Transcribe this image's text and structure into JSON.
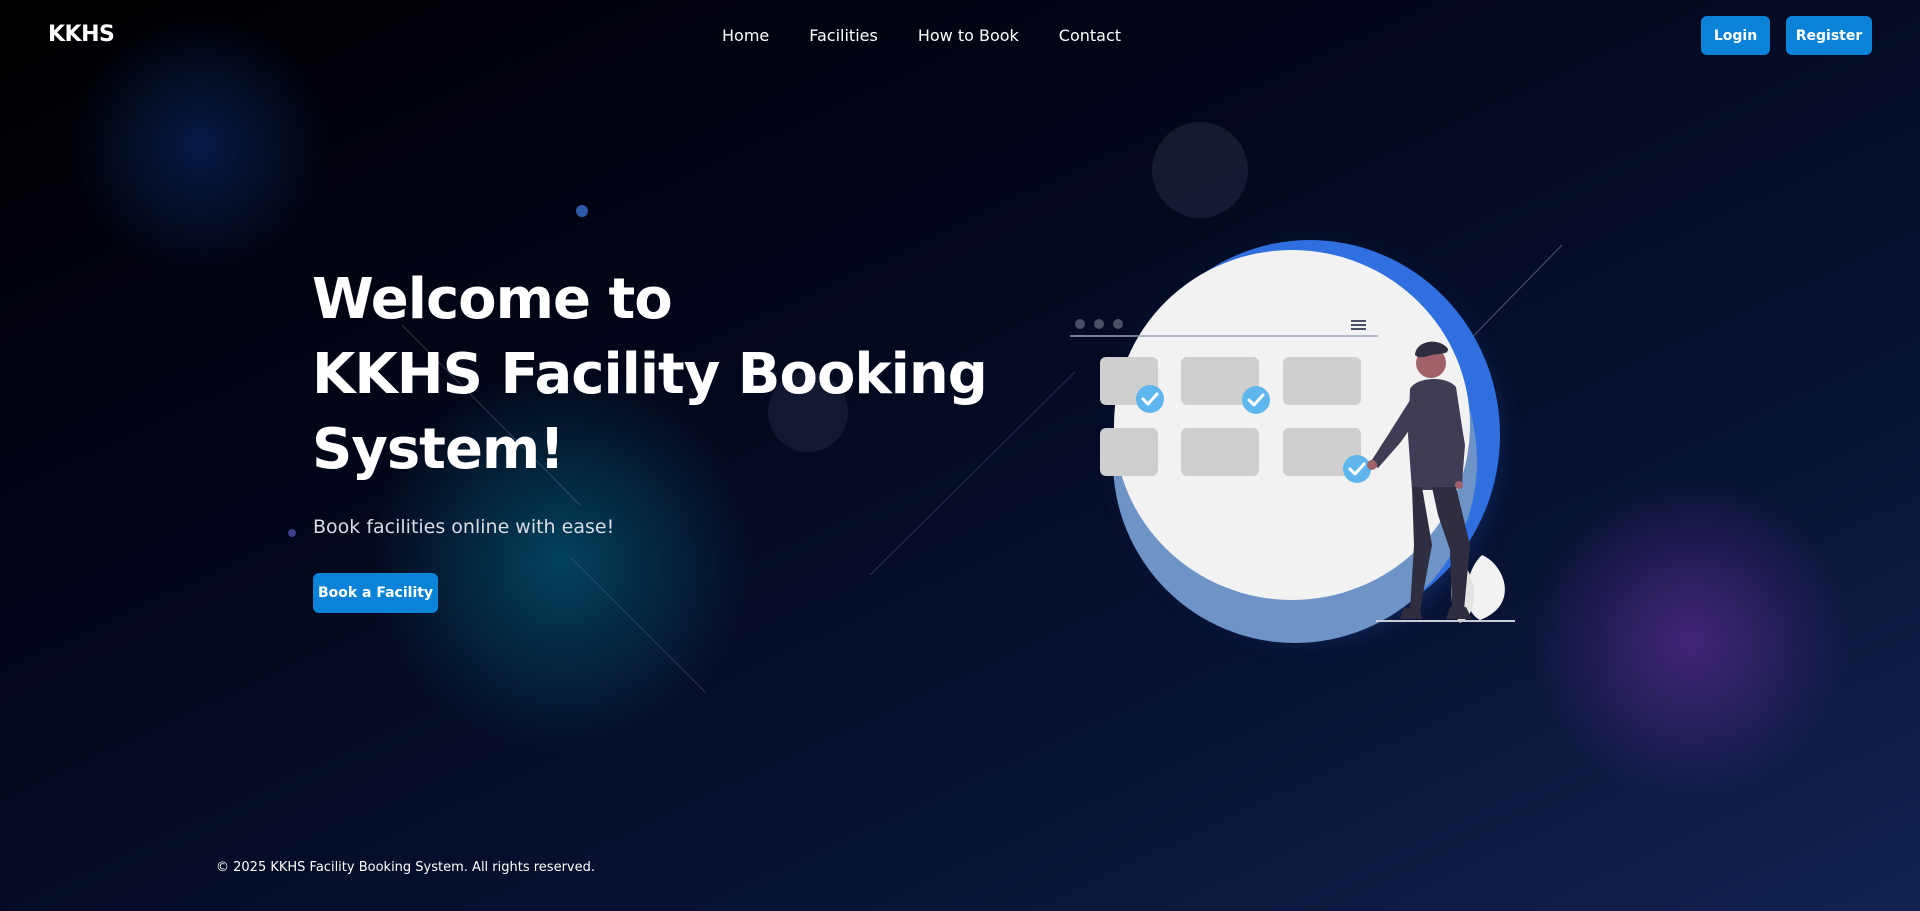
{
  "header": {
    "brand": "KKHS",
    "nav": [
      "Home",
      "Facilities",
      "How to Book",
      "Contact"
    ],
    "login_label": "Login",
    "register_label": "Register"
  },
  "hero": {
    "title_lines": [
      "Welcome to",
      "KKHS Facility Booking",
      "System!"
    ],
    "subtitle": "Book facilities online with ease!",
    "cta_label": "Book a Facility"
  },
  "footer": {
    "copyright": "© 2025 KKHS Facility Booking System. All rights reserved."
  },
  "colors": {
    "accent": "#0a82d8",
    "background_dark": "#000000",
    "background_light": "#13224f",
    "illustration_blue": "#2f6fe0",
    "check_blue": "#5fb6ee"
  },
  "icons": {
    "menu": "hamburger-menu-icon",
    "check": "check-circle-icon",
    "window_dots": "window-dots-icon"
  }
}
